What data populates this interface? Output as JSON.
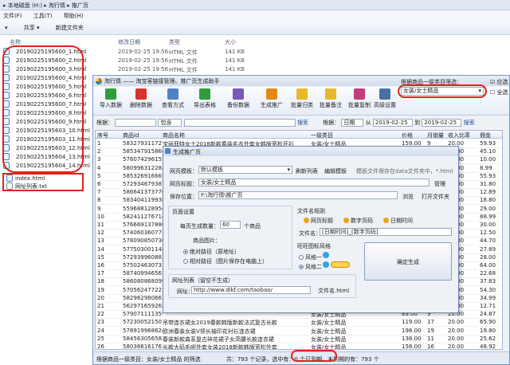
{
  "explorer": {
    "breadcrumb": "▸ 本地磁盘 (H:) ▸ 淘行情 ▸ 推广页",
    "menu": [
      "文件(F)",
      "工具(T)",
      "帮助(H)"
    ],
    "toolbar": [
      "▾",
      "共享 ▾",
      "新建文件夹"
    ],
    "columns": [
      "名称",
      "修改日期",
      "类型",
      "大小"
    ],
    "files": [
      {
        "name": "20190225195600_1.html",
        "date": "2019-02-25 19:56",
        "type": "HTML 文件",
        "size": "141 KB"
      },
      {
        "name": "20190225195600_2.html",
        "date": "2019-02-25 19:56",
        "type": "HTML 文件",
        "size": "141 KB"
      },
      {
        "name": "20190225195600_3.html",
        "date": "2019-02-25 19:56",
        "type": "HTML 文件",
        "size": "141 KB"
      },
      {
        "name": "20190225195600_4.html",
        "date": "",
        "type": "",
        "size": ""
      },
      {
        "name": "20190225195600_5.html",
        "date": "",
        "type": "",
        "size": ""
      },
      {
        "name": "20190225195600_6.html",
        "date": "",
        "type": "",
        "size": ""
      },
      {
        "name": "20190225195600_7.html",
        "date": "",
        "type": "",
        "size": ""
      },
      {
        "name": "20190225195600_8.html",
        "date": "",
        "type": "",
        "size": ""
      },
      {
        "name": "20190225195600_9.html",
        "date": "",
        "type": "",
        "size": ""
      },
      {
        "name": "20190225195603_10.html",
        "date": "",
        "type": "",
        "size": ""
      },
      {
        "name": "20190225195603_11.html",
        "date": "",
        "type": "",
        "size": ""
      },
      {
        "name": "20190225195603_12.html",
        "date": "",
        "type": "",
        "size": ""
      },
      {
        "name": "20190225195604_13.html",
        "date": "",
        "type": "",
        "size": ""
      },
      {
        "name": "20190225195604_14.html",
        "date": "",
        "type": "",
        "size": ""
      }
    ],
    "extra_files": [
      "index.html",
      "网址列表.txt"
    ]
  },
  "app": {
    "title": "淘行情 —— 淘宝客链接管理、推广页生成助手",
    "toolbar": [
      {
        "label": "导入数据",
        "color": "#2e9d3a"
      },
      {
        "label": "删除数据",
        "color": "#d8322b"
      },
      {
        "label": "查看方式",
        "color": "#4f82c6"
      },
      {
        "label": "导出表格",
        "color": "#2e9d3a"
      },
      {
        "label": "备份数据",
        "color": "#7a58b8"
      },
      {
        "label": "生成推广",
        "color": "#e08a1a"
      },
      {
        "label": "批量归类",
        "color": "#e8b82a"
      },
      {
        "label": "批量备注",
        "color": "#e8b82a"
      },
      {
        "label": "批量复制",
        "color": "#c23d7e"
      },
      {
        "label": "高级设置",
        "color": "#4a6fa5"
      }
    ],
    "category_label": "根据商品一级类目筛选：",
    "category_value": "女装/女士精品",
    "apply_label": "应选",
    "all_label": "全选",
    "filter": {
      "by_label": "根据：",
      "keyword_placeholder": "",
      "op": "包含",
      "search": "搜索",
      "date_label": "根据：",
      "date_field": "日期",
      "from_label": "从",
      "from": "2019-02-25",
      "to_label": "到",
      "to": "2019-02-25",
      "search2": "搜索"
    },
    "grid_columns": [
      "序号",
      "商品id",
      "商品名称",
      "一级类目",
      "价格",
      "月销量",
      "收入比率",
      "佣金"
    ],
    "grid_rows": [
      [
        "1",
        "583279311727",
        "宝丽菲特女士2018新款春装毛衣外套女韩版宽松开衫",
        "女装/女士精品",
        "159.00",
        "9",
        "20.00",
        "59.93"
      ],
      [
        "2",
        "585347915864",
        "小个子连衣裙女2019春新款女装法式复古气质裙子",
        "女装/女士精品",
        "129.00",
        "11",
        "20.00",
        "45.10"
      ],
      [
        "3",
        "576074296155",
        "",
        "女装/女士精品",
        "128.00",
        "33",
        "20.00",
        "10.00"
      ],
      [
        "4",
        "580996312284",
        "",
        "女装/女士精品",
        "99.00",
        "24",
        "20.00",
        "8.99"
      ],
      [
        "5",
        "585326916665",
        "",
        "女装/女士精品",
        "99.00",
        "17",
        "20.00",
        "55.93"
      ],
      [
        "6",
        "572934679387",
        "",
        "女装/女士精品",
        "159.00",
        "40",
        "20.00",
        "31.80"
      ],
      [
        "7",
        "586641373776",
        "",
        "女装/女士精品",
        "139.00",
        "9",
        "20.00",
        "12.89"
      ],
      [
        "8",
        "583404119938",
        "",
        "女装/女士精品",
        "168.00",
        "9",
        "20.00",
        "18.80"
      ],
      [
        "9",
        "559688128954",
        "",
        "女装/女士精品",
        "229.00",
        "9",
        "20.00",
        "29.00"
      ],
      [
        "10",
        "582411276714",
        "",
        "女装/女士精品",
        "89.00",
        "17",
        "20.00",
        "88.99"
      ],
      [
        "11",
        "576669137880",
        "",
        "女装/女士精品",
        "79.00",
        "25",
        "20.00",
        "30.00"
      ],
      [
        "12",
        "574060360773",
        "",
        "女装/女士精品",
        "119.00",
        "13",
        "20.00",
        "12.50"
      ],
      [
        "13",
        "578090850736",
        "",
        "女装/女士精品",
        "138.00",
        "29",
        "20.00",
        "44.70"
      ],
      [
        "14",
        "577503001148",
        "",
        "女装/女士精品",
        "108.00",
        "28",
        "20.00",
        "27.89"
      ],
      [
        "15",
        "572939960883",
        "",
        "女装/女士精品",
        "169.00",
        "18",
        "20.00",
        "28.00"
      ],
      [
        "16",
        "575024630733",
        "",
        "女装/女士精品",
        "99.00",
        "21",
        "20.00",
        "64.00"
      ],
      [
        "17",
        "587409946561",
        "",
        "女装/女士精品",
        "189.00",
        "20",
        "20.00",
        "22.68"
      ],
      [
        "18",
        "586080868099",
        "",
        "女装/女士精品",
        "168.00",
        "17",
        "20.00",
        "37.83"
      ],
      [
        "19",
        "570562477225",
        "",
        "女装/女士精品",
        "149.00",
        "13",
        "20.00",
        "54.30"
      ],
      [
        "20",
        "582962980663",
        "",
        "女装/女士精品",
        "79.00",
        "35",
        "20.00",
        "34.99"
      ],
      [
        "21",
        "562971659262",
        "",
        "女装/女士精品",
        "148.00",
        "41",
        "20.00",
        "12.71"
      ],
      [
        "22",
        "579071111356",
        "",
        "女装/女士精品",
        "89.00",
        "9",
        "20.00",
        "24.87"
      ],
      [
        "23",
        "572300521507",
        "吊带连衣裙女2019春款韩版新款法式复古长款",
        "女装/女士精品",
        "119.00",
        "17",
        "20.00",
        "65.90"
      ],
      [
        "24",
        "578919968624",
        "欧洲春装女装V领长袖印花衬衫连衣裙",
        "女装/女士精品",
        "198.00",
        "19",
        "20.00",
        "19.80"
      ],
      [
        "25",
        "584563056582",
        "春装新款森系复古碎花裙子女高腰长款连衣裙",
        "女装/女士精品",
        "138.00",
        "11",
        "20.00",
        "25.62"
      ],
      [
        "26",
        "580366161763",
        "长款大码毛呢外套女装2018新款韩版宽松外套",
        "女装/女士精品",
        "158.00",
        "16",
        "20.00",
        "48.92"
      ]
    ],
    "status": {
      "prefix": "根据商品一级类目：女装/女士精品 的筛选",
      "total": "共：793 个记录，",
      "selected": "选中有：0 个已到期，未到期的有：793 个"
    }
  },
  "dialog": {
    "title": "生成推广页",
    "template_label": "网页模板：",
    "template_value": "默认模板",
    "refresh": "刷新列表",
    "edit": "编辑模板",
    "template_hint": "模板文件保存在data文件夹中，*.html",
    "page_title_label": "网页标题：",
    "page_title_value": "女装/女士精品",
    "manage": "管理",
    "save_label": "保存位置：",
    "save_value": "F:\\淘行情\\推广页",
    "browse": "浏览",
    "open_folder": "打开文件夹",
    "page_setting": "页面设置",
    "per_page_label": "每页生成数量：",
    "per_page_value": "60",
    "per_page_unit": "个商品",
    "image_label": "商品图片：",
    "image_opt1": "绝对路径（原地址）",
    "image_opt2": "相对路径（图片保存在电脑上）",
    "filename_rule": "文件名规则",
    "rule_opt1": "网页标题",
    "rule_opt2": "数字页码",
    "rule_opt3": "日期时间",
    "filename_label": "文件名：",
    "filename_value": "[日期时间]_[数字页码]",
    "style_label": "旺旺图标风格",
    "style1": "风格一",
    "style2": "风格二",
    "url_group": "网址列表（留空不生成）",
    "url_label": "网址：",
    "url_value": "http://www.dlkf.com/taobao/",
    "url_file": "文件名.html",
    "generate": "确定生成"
  }
}
